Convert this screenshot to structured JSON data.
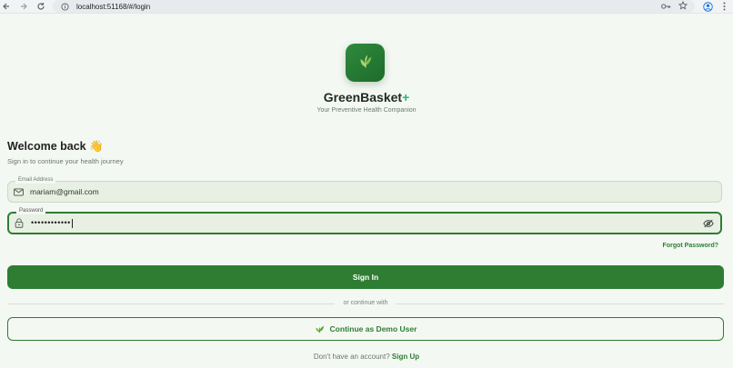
{
  "browser": {
    "url": "localhost:51168/#/login"
  },
  "app": {
    "name": "GreenBasket",
    "name_suffix": "+",
    "tagline": "Your Preventive Health Companion"
  },
  "login": {
    "title": "Welcome back 👋",
    "subtitle": "Sign in to continue your health journey",
    "email_label": "Email Address",
    "email_value": "mariam@gmail.com",
    "password_label": "Password",
    "password_value": "••••••••••••",
    "forgot_label": "Forgot Password?",
    "signin_label": "Sign In",
    "divider_text": "or continue with",
    "demo_label": "Continue as Demo User",
    "signup_prompt": "Don't have an account?",
    "signup_link": "Sign Up"
  },
  "colors": {
    "primary": "#2e7d32",
    "accent": "#2bb673",
    "background": "#f4f8f3"
  },
  "icons": [
    "back-icon",
    "forward-icon",
    "reload-icon",
    "site-info-icon",
    "password-key-icon",
    "bookmark-star-icon",
    "profile-icon",
    "menu-icon",
    "leaf-logo-icon",
    "mail-icon",
    "lock-icon",
    "eye-off-icon",
    "leaf-icon"
  ]
}
